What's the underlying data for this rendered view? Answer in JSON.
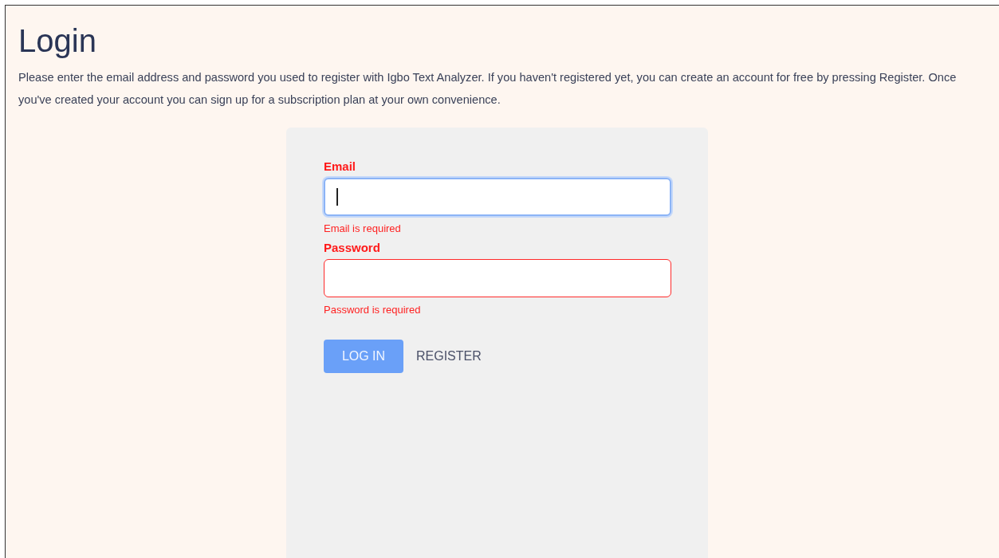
{
  "page": {
    "title": "Login",
    "intro": "Please enter the email address and password you used to register with Igbo Text Analyzer. If you haven't registered yet, you can create an account for free by pressing Register. Once you've created your account you can sign up for a subscription plan at your own convenience."
  },
  "form": {
    "fields": [
      {
        "label": "Email",
        "focused": true,
        "error": "Email is required"
      },
      {
        "label": "Password",
        "focused": false,
        "error": "Password is required"
      }
    ],
    "buttons": [
      {
        "label": "LOG IN",
        "kind": "primary"
      },
      {
        "label": "REGISTER",
        "kind": "text"
      }
    ]
  }
}
